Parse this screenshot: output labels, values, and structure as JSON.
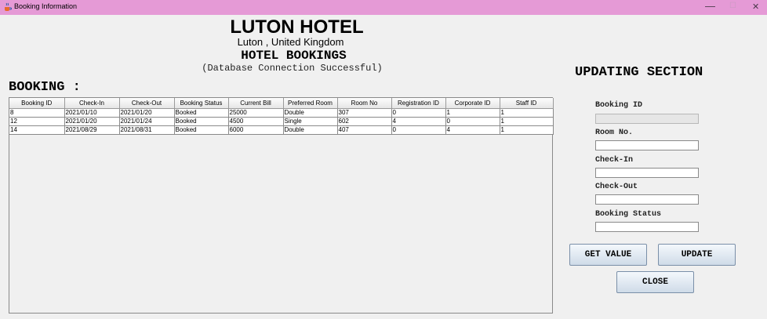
{
  "window": {
    "title": "Booking Information",
    "controls": {
      "minimize": "—",
      "maximize": "☐",
      "close": "✕"
    }
  },
  "header": {
    "hotel_name": "LUTON HOTEL",
    "location": "Luton , United Kingdom",
    "bookings_title": "HOTEL BOOKINGS",
    "db_status": "(Database Connection Successful)"
  },
  "booking_section": {
    "title": "BOOKING :"
  },
  "table": {
    "columns": [
      "Booking ID",
      "Check-In",
      "Check-Out",
      "Booking Status",
      "Current Bill",
      "Preferred Room",
      "Room No",
      "Registration ID",
      "Corporate ID",
      "Staff ID"
    ],
    "rows": [
      [
        "8",
        "2021/01/10",
        "2021/01/20",
        "Booked",
        "25000",
        "Double",
        "307",
        "0",
        "1",
        "1"
      ],
      [
        "12",
        "2021/01/20",
        "2021/01/24",
        "Booked",
        "4500",
        "Single",
        "602",
        "4",
        "0",
        "1"
      ],
      [
        "14",
        "2021/08/29",
        "2021/08/31",
        "Booked",
        "6000",
        "Double",
        "407",
        "0",
        "4",
        "1"
      ]
    ]
  },
  "update_section": {
    "title": "UPDATING SECTION",
    "fields": [
      {
        "label": "Booking ID",
        "value": ""
      },
      {
        "label": "Room No.",
        "value": ""
      },
      {
        "label": "Check-In",
        "value": ""
      },
      {
        "label": "Check-Out",
        "value": ""
      },
      {
        "label": "Booking Status",
        "value": ""
      }
    ],
    "buttons": {
      "get_value": "GET VALUE",
      "update": "UPDATE",
      "close": "CLOSE"
    }
  },
  "colors": {
    "titlebar": "#e59ad6",
    "window_bg": "#f0f0f0",
    "button_border": "#7a8fa8"
  },
  "icons": {
    "app": "java-coffee-icon"
  }
}
